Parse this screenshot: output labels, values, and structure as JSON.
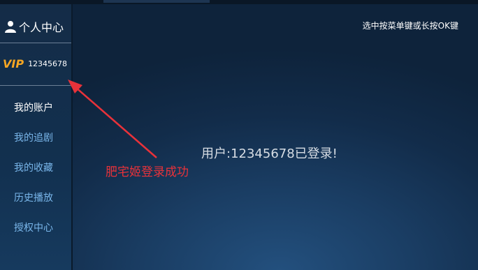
{
  "sidebar": {
    "header_title": "个人中心",
    "vip_badge": "VIP",
    "vip_account": "12345678",
    "menu": [
      {
        "label": "我的账户",
        "active": true
      },
      {
        "label": "我的追剧",
        "active": false
      },
      {
        "label": "我的收藏",
        "active": false
      },
      {
        "label": "历史播放",
        "active": false
      },
      {
        "label": "授权中心",
        "active": false
      }
    ]
  },
  "main": {
    "hint": "选中按菜单键或长按OK键",
    "login_message": "用户:12345678已登录!"
  },
  "annotation": {
    "text": "肥宅姬登录成功"
  },
  "colors": {
    "vip_gold": "#f5a623",
    "menu_inactive": "#79b6ea",
    "menu_active": "#ffffff",
    "annotation_red": "#e8323a",
    "background": "#1a3d63"
  },
  "icons": {
    "profile": "person-icon",
    "annotation": "arrow-icon"
  }
}
